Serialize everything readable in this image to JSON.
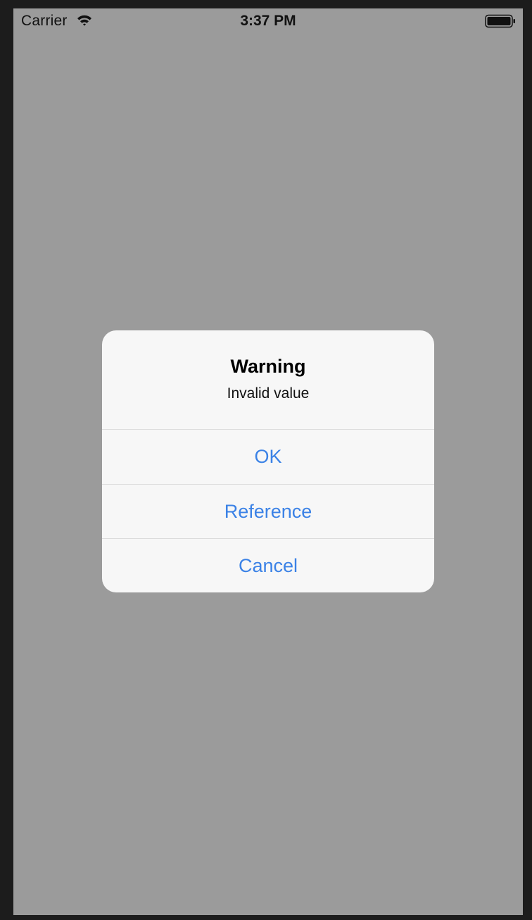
{
  "status_bar": {
    "carrier": "Carrier",
    "time": "3:37 PM",
    "wifi_icon": "wifi-icon",
    "battery_icon": "battery-icon"
  },
  "alert": {
    "title": "Warning",
    "message": "Invalid value",
    "actions": [
      {
        "label": "OK"
      },
      {
        "label": "Reference"
      },
      {
        "label": "Cancel"
      }
    ]
  },
  "colors": {
    "action_text": "#3b82e6",
    "dim_background": "#9b9b9b",
    "alert_background": "#f7f7f7",
    "device_frame": "#1c1c1c"
  }
}
